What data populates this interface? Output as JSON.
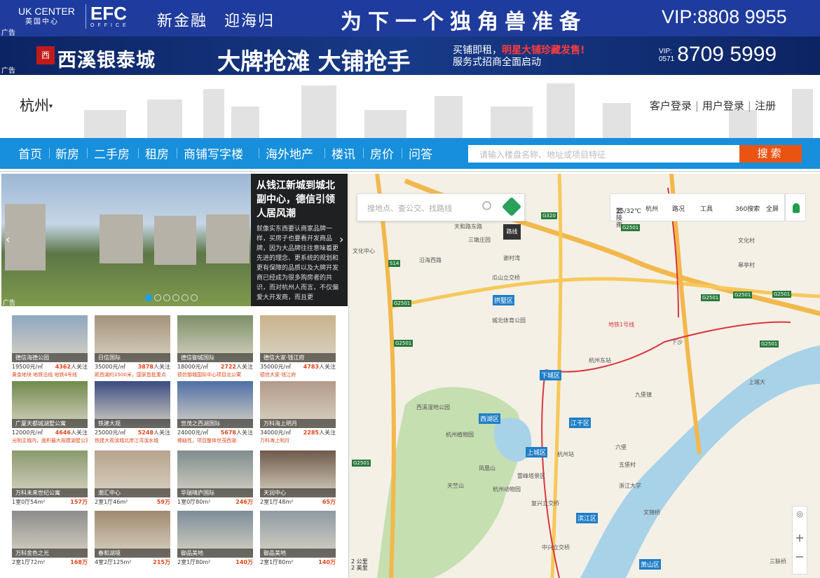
{
  "ad_top": {
    "uk": "UK CENTER",
    "uk_sub": "英国中心",
    "efc": "EFC",
    "efc_sub": "OFFICE",
    "slogan1": "新金融　迎海归",
    "slogan2": "为下一个独角兽准备",
    "vip": "VIP:8808 9955",
    "ad_label": "广告"
  },
  "ad_second": {
    "brand": "西溪银泰城",
    "headline": "大牌抢滩 大铺抢手",
    "sub1_a": "买铺即租，",
    "sub1_b": "明星大铺珍藏发售!",
    "sub2": "服务式招商全面启动",
    "vip_prefix": "VIP:",
    "area": "0571",
    "vip": "8709 5999",
    "ad_label": "广告"
  },
  "header": {
    "city": "杭州",
    "caret": "▾",
    "links": [
      "客户登录",
      "用户登录",
      "注册"
    ]
  },
  "nav": {
    "items": [
      "首页",
      "新房",
      "二手房",
      "租房",
      "商铺写字楼",
      "海外地产",
      "楼讯",
      "房价",
      "问答"
    ],
    "search_placeholder": "请输入楼盘名称、地址或项目特征",
    "search_button": "搜索"
  },
  "slider": {
    "title": "从钱江新城到城北副中心，德信引领人居风潮",
    "body": "就像实东西要认商家品牌一样，买房子也要看开发商品牌，因为大品牌往往意味着更先进的理念、更系统的规划和更有保障的品质以及大牌开发商已经成为很多购房者的共识，而对杭州人而言，不仅偏爱大开发商，而且更",
    "ad_label": "广告",
    "dots": 6
  },
  "listings": [
    {
      "name": "德信海德公园",
      "price": "19500元/㎡",
      "follow": "4362",
      "suffix": "人关注",
      "tag": "黄金地块 地铁沿线 地铁4号线",
      "color": "#8fa7c0"
    },
    {
      "name": "日信国际",
      "price": "35000元/㎡",
      "follow": "3878",
      "suffix": "人关注",
      "tag": "距西湖约1500米，国家首批重点",
      "color": "#a4927a"
    },
    {
      "name": "德信御城国际",
      "price": "18000元/㎡",
      "follow": "2722",
      "suffix": "人关注",
      "tag": "德信御城国际中心项目北公寓",
      "color": "#7c8f68"
    },
    {
      "name": "德信大家·钱江府",
      "price": "35000元/㎡",
      "follow": "4783",
      "suffix": "人关注",
      "tag": "德信大家·钱江府",
      "color": "#c9b38c"
    },
    {
      "name": "广厦天都城湖墅公寓",
      "price": "12000元/㎡",
      "follow": "4646",
      "suffix": "人关注",
      "tag": "光明主城内，面积最大规模湖墅公寓",
      "color": "#6f8a4b"
    },
    {
      "name": "铁建大观",
      "price": "25000元/㎡",
      "follow": "5248",
      "suffix": "人关注",
      "tag": "铁建大观滨城北岸江湾滨水城",
      "color": "#3b4c82"
    },
    {
      "name": "世茂之西湖国际",
      "price": "24000元/㎡",
      "follow": "5678",
      "suffix": "人关注",
      "tag": "稀缺性，项目整体世茂西湖",
      "color": "#4e6fa6"
    },
    {
      "name": "万科海上明月",
      "price": "34000元/㎡",
      "follow": "2285",
      "suffix": "人关注",
      "tag": "万科海上明月",
      "color": "#b39b8a"
    },
    {
      "name": "万科未来世纪公寓",
      "price": "1室0厅54m²",
      "follow": "157万",
      "suffix": "",
      "tag": "",
      "color": "#8a9a6e"
    },
    {
      "name": "潮汇中心",
      "price": "2室1厅46m²",
      "follow": "59万",
      "suffix": "",
      "tag": "",
      "color": "#b7a38c"
    },
    {
      "name": "华瑞晴庐国际",
      "price": "1室0厅80m²",
      "follow": "246万",
      "suffix": "",
      "tag": "",
      "color": "#7f8c8f"
    },
    {
      "name": "天润中心",
      "price": "2室1厅48m²",
      "follow": "65万",
      "suffix": "",
      "tag": "",
      "color": "#6e5a4a"
    },
    {
      "name": "万科金色之光",
      "price": "2室1厅72m²",
      "follow": "168万",
      "suffix": "",
      "tag": "",
      "color": "#8c8c8c"
    },
    {
      "name": "春和湖境",
      "price": "4室2厅125m²",
      "follow": "215万",
      "suffix": "",
      "tag": "",
      "color": "#a08a70"
    },
    {
      "name": "御品美地",
      "price": "2室1厅80m²",
      "follow": "140万",
      "suffix": "",
      "tag": "",
      "color": "#7d8d9a"
    },
    {
      "name": "御品美地",
      "price": "2室1厅80m²",
      "follow": "140万",
      "suffix": "",
      "tag": "",
      "color": "#8e9aa3"
    }
  ],
  "map": {
    "search_placeholder": "搜地点、查公交、找路线",
    "route_tip": "路线",
    "weather": "蓝陵雨",
    "temperature": "25/32℃",
    "tools": [
      "杭州",
      "路况",
      "工具",
      "360搜索",
      "全屏"
    ],
    "scale_km": "2 公里",
    "scale_mi": "2 英里",
    "zoom_in": "+",
    "zoom_out": "−",
    "compass": "◎",
    "subway_label": "地铁1号线",
    "labels": [
      "天和路东路",
      "三墩庄园",
      "谢村湾",
      "瓜山立交桥",
      "城北体育公园",
      "杭州东站",
      "西溪湿地公园",
      "九堡镇",
      "杭州植物园",
      "杭州站",
      "凤凰山",
      "天竺山",
      "杭州动物园",
      "雷峰塔景区",
      "复兴立交桥",
      "中兴立交桥",
      "文锦桥",
      "三联桥",
      "浙江大学",
      "文化村",
      "下沙",
      "六堡",
      "上城大",
      "皋亭村",
      "文化中心",
      "沿海西路",
      "五堡村"
    ],
    "districts": [
      "拱墅区",
      "下城区",
      "西湖区",
      "江干区",
      "上城区",
      "滨江区",
      "萧山区"
    ],
    "shields": [
      "G320",
      "G2501",
      "G2501",
      "G2501",
      "G2501",
      "G2501",
      "S14",
      "G2501",
      "G2501",
      "G2501"
    ]
  }
}
